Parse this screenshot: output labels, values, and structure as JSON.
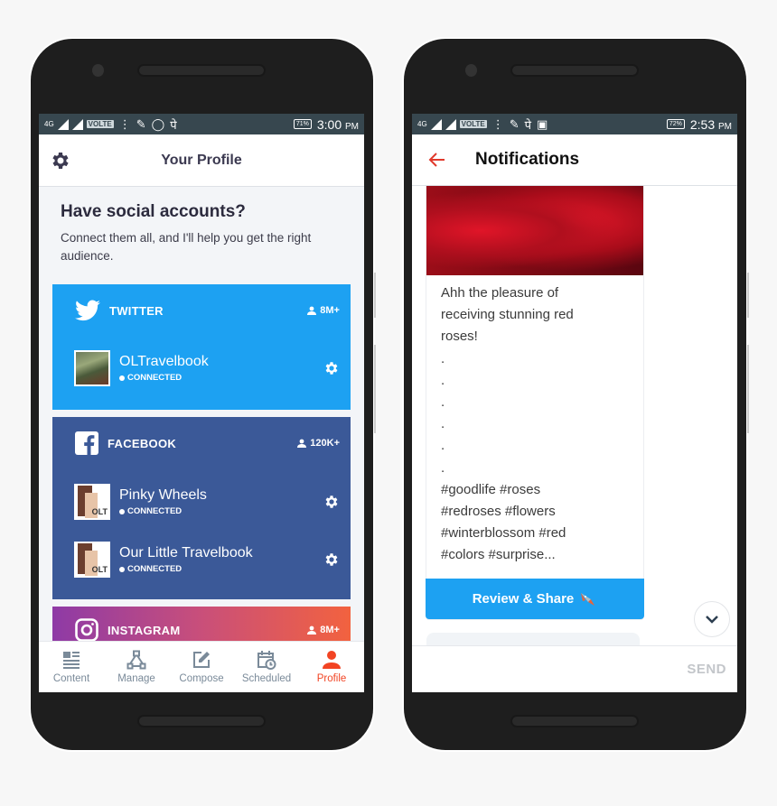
{
  "left_phone": {
    "status_bar": {
      "network": "4G",
      "volte": "VOLTE",
      "icons": [
        "signal-icon",
        "signal-icon",
        "battery-saver-icon",
        "whatsapp-icon",
        "pe-icon"
      ],
      "pe_glyph": "पे",
      "battery": "71%",
      "time": "3:00",
      "ampm": "PM"
    },
    "header": {
      "title": "Your Profile",
      "left_icon": "gear-icon"
    },
    "intro": {
      "heading": "Have social accounts?",
      "text": "Connect them all, and I'll help you get the right audience."
    },
    "networks": [
      {
        "name": "TWITTER",
        "audience": "8M+",
        "color": "#1da1f2",
        "accounts": [
          {
            "name": "OLTravelbook",
            "status": "CONNECTED"
          }
        ]
      },
      {
        "name": "FACEBOOK",
        "audience": "120K+",
        "color": "#3b5998",
        "accounts": [
          {
            "name": "Pinky Wheels",
            "status": "CONNECTED",
            "avatar_text": "OLT"
          },
          {
            "name": "Our Little Travelbook",
            "status": "CONNECTED",
            "avatar_text": "OLT"
          }
        ]
      },
      {
        "name": "INSTAGRAM",
        "audience": "8M+"
      }
    ],
    "bottom_nav": [
      {
        "label": "Content",
        "icon": "content-icon"
      },
      {
        "label": "Manage",
        "icon": "manage-icon"
      },
      {
        "label": "Compose",
        "icon": "compose-icon"
      },
      {
        "label": "Scheduled",
        "icon": "scheduled-icon"
      },
      {
        "label": "Profile",
        "icon": "profile-icon",
        "active": true
      }
    ],
    "accent": "#f24423"
  },
  "right_phone": {
    "status_bar": {
      "network": "4G",
      "volte": "VOLTE",
      "pe_glyph": "पे",
      "battery": "72%",
      "time": "2:53",
      "ampm": "PM"
    },
    "header": {
      "title": "Notifications",
      "back_icon": "arrow-left-icon"
    },
    "post": {
      "lines": [
        "Ahh the pleasure of",
        "receiving stunning red",
        "roses!",
        ".",
        ".",
        ".",
        ".",
        ".",
        ".",
        "#goodlife #roses",
        "#redroses #flowers",
        "#winterblossom #red",
        "#colors #surprise..."
      ],
      "button_label": "Review & Share",
      "button_icon": "rocket-icon"
    },
    "composer": {
      "send_label": "SEND"
    }
  }
}
